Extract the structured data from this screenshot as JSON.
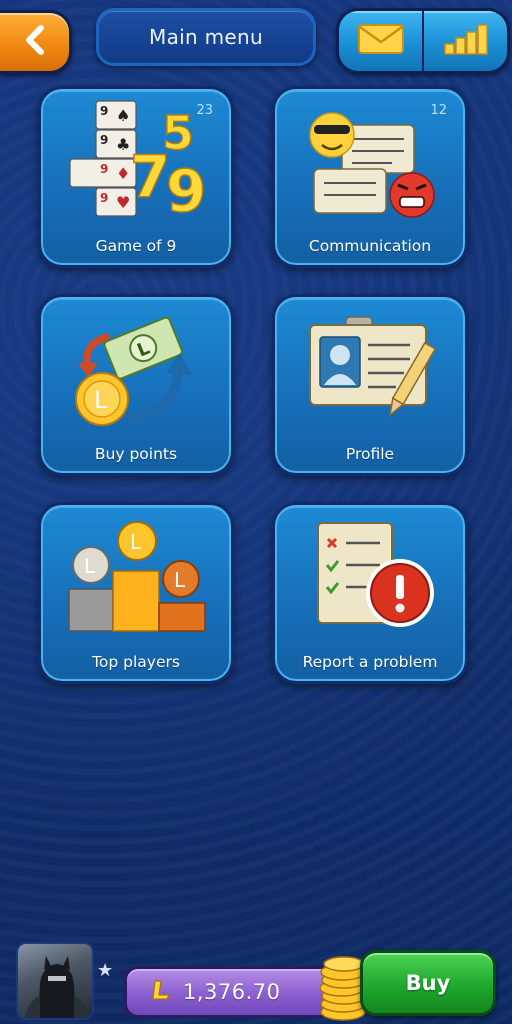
{
  "header": {
    "title": "Main menu",
    "back_icon": "chevron-left-icon",
    "mail_icon": "envelope-icon",
    "stats_icon": "bar-chart-icon"
  },
  "tiles": [
    {
      "label": "Game of 9",
      "count": "23",
      "icon": "playing-cards-icon"
    },
    {
      "label": "Communication",
      "count": "12",
      "icon": "chat-bubbles-icon"
    },
    {
      "label": "Buy points",
      "count": "",
      "icon": "money-exchange-icon"
    },
    {
      "label": "Profile",
      "count": "",
      "icon": "id-card-icon"
    },
    {
      "label": "Top players",
      "count": "",
      "icon": "podium-medals-icon"
    },
    {
      "label": "Report a problem",
      "count": "",
      "icon": "report-alert-icon"
    }
  ],
  "footer": {
    "balance": "1,376.70",
    "currency_icon": "l-coin-icon",
    "buy_label": "Buy",
    "avatar": "avatar"
  },
  "colors": {
    "background": "#14327a",
    "tile": "#1a7cc8",
    "back_button": "#f08a12",
    "top_icons": "#1b8fd4",
    "balance": "#8a5fcf",
    "buy_button": "#1fa82e"
  }
}
